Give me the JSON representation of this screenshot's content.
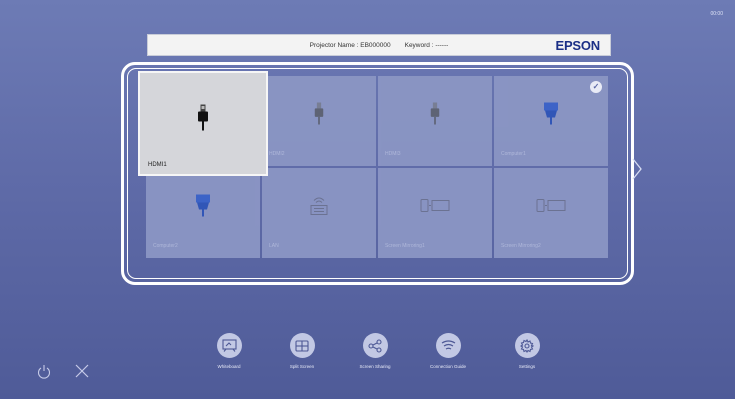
{
  "clock": "00:00",
  "header": {
    "projector_name": "Projector Name : EB000000",
    "keyword": "Keyword : ------",
    "brand": "EPSON"
  },
  "sources": [
    {
      "label": "HDMI1",
      "icon": "hdmi-plug-icon",
      "selected": true,
      "checked": false
    },
    {
      "label": "HDMI2",
      "icon": "hdmi-plug-icon",
      "selected": false,
      "checked": false
    },
    {
      "label": "HDMI3",
      "icon": "hdmi-plug-icon",
      "selected": false,
      "checked": false
    },
    {
      "label": "Computer1",
      "icon": "vga-plug-icon",
      "selected": false,
      "checked": true
    },
    {
      "label": "Computer2",
      "icon": "vga-plug-icon",
      "selected": false,
      "checked": false
    },
    {
      "label": "LAN",
      "icon": "lan-icon",
      "selected": false,
      "checked": false
    },
    {
      "label": "Screen Mirroring1",
      "icon": "screen-mirroring-icon",
      "selected": false,
      "checked": false
    },
    {
      "label": "Screen Mirroring2",
      "icon": "screen-mirroring-icon",
      "selected": false,
      "checked": false
    }
  ],
  "bottom_menu": [
    {
      "label": "Whiteboard",
      "icon": "whiteboard-icon"
    },
    {
      "label": "Split Screen",
      "icon": "split-screen-icon"
    },
    {
      "label": "Screen Sharing",
      "icon": "share-icon"
    },
    {
      "label": "Connection Guide",
      "icon": "wifi-icon"
    },
    {
      "label": "Settings",
      "icon": "gear-icon"
    }
  ],
  "colors": {
    "accent": "#1b2f86",
    "background": "#5f6ba8",
    "selected_tile": "#d5d6da"
  }
}
